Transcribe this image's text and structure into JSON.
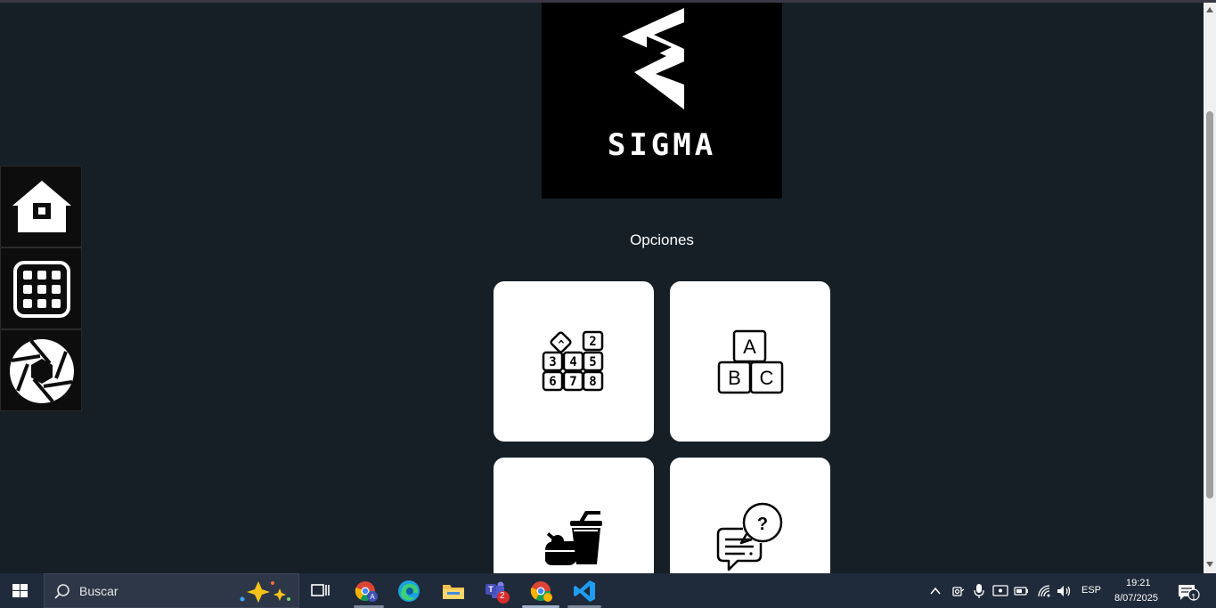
{
  "brand": {
    "logo_text": "SIGMA"
  },
  "main": {
    "section_title": "Opciones"
  },
  "cards": [
    {
      "name": "numbers-card",
      "icon": "number-blocks-icon"
    },
    {
      "name": "letters-card",
      "icon": "abc-blocks-icon"
    },
    {
      "name": "food-card",
      "icon": "food-drink-icon"
    },
    {
      "name": "questions-card",
      "icon": "question-chat-icon"
    }
  ],
  "sidebar": [
    {
      "name": "home",
      "icon": "home-icon"
    },
    {
      "name": "apps",
      "icon": "grid-icon"
    },
    {
      "name": "camera",
      "icon": "aperture-icon"
    }
  ],
  "taskbar": {
    "search_placeholder": "Buscar",
    "language": "ESP",
    "time": "19:21",
    "date": "8/07/2025",
    "teams_badge": "2",
    "notification_count": "1"
  },
  "colors": {
    "background": "#161f26",
    "card": "#ffffff",
    "taskbar": "#1f2a3a"
  }
}
